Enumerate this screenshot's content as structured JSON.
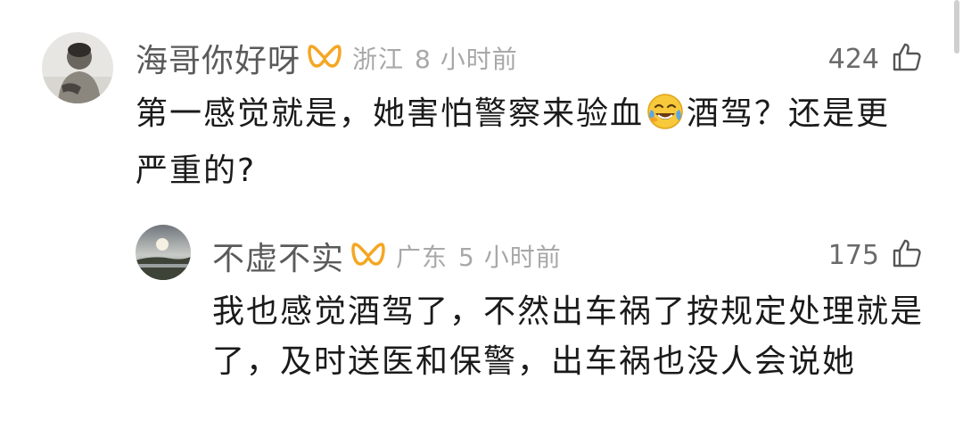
{
  "comments": [
    {
      "username": "海哥你好呀",
      "location": "浙江",
      "time": "8 小时前",
      "likes": "424",
      "text_before_emoji": "第一感觉就是，她害怕警察来验血",
      "text_after_emoji": "酒驾？还是更严重的?",
      "emoji": "crying-laughing-emoji"
    },
    {
      "username": "不虚不实",
      "location": "广东",
      "time": "5 小时前",
      "likes": "175",
      "text": "我也感觉酒驾了，不然出车祸了按规定处理就是了，及时送医和保警，出车祸也没人会说她"
    }
  ],
  "colors": {
    "username": "#5a5a5a",
    "meta": "#a8a8a8",
    "badge": "#f5a623",
    "text": "#1a1a1a"
  },
  "icons": {
    "badge": "vip-badge-icon",
    "like": "thumbs-up-icon"
  }
}
